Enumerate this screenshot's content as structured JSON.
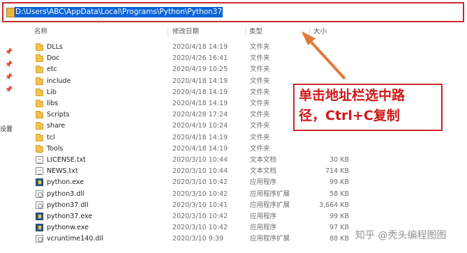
{
  "address_bar": {
    "path": "D:\\Users\\ABC\\AppData\\Local\\Programs\\Python\\Python37"
  },
  "columns": {
    "name": "名称",
    "date": "修改日期",
    "type": "类型",
    "size": "大小"
  },
  "left_panel": {
    "label": "设置"
  },
  "files": [
    {
      "name": "DLLs",
      "date": "2020/4/18 14:19",
      "type": "文件夹",
      "size": "",
      "icon": "folder"
    },
    {
      "name": "Doc",
      "date": "2020/4/26 16:41",
      "type": "文件夹",
      "size": "",
      "icon": "folder"
    },
    {
      "name": "etc",
      "date": "2020/4/19 10:25",
      "type": "文件夹",
      "size": "",
      "icon": "folder"
    },
    {
      "name": "include",
      "date": "2020/4/18 14:19",
      "type": "文件夹",
      "size": "",
      "icon": "folder"
    },
    {
      "name": "Lib",
      "date": "2020/4/18 14:19",
      "type": "文件夹",
      "size": "",
      "icon": "folder"
    },
    {
      "name": "libs",
      "date": "2020/4/18 14:19",
      "type": "文件夹",
      "size": "",
      "icon": "folder"
    },
    {
      "name": "Scripts",
      "date": "2020/4/28 17:24",
      "type": "文件夹",
      "size": "",
      "icon": "folder"
    },
    {
      "name": "share",
      "date": "2020/4/19 10:24",
      "type": "文件夹",
      "size": "",
      "icon": "folder"
    },
    {
      "name": "tcl",
      "date": "2020/4/18 14:19",
      "type": "文件夹",
      "size": "",
      "icon": "folder"
    },
    {
      "name": "Tools",
      "date": "2020/4/18 14:19",
      "type": "文件夹",
      "size": "",
      "icon": "folder"
    },
    {
      "name": "LICENSE.txt",
      "date": "2020/3/10 10:44",
      "type": "文本文档",
      "size": "30 KB",
      "icon": "text"
    },
    {
      "name": "NEWS.txt",
      "date": "2020/3/10 10:44",
      "type": "文本文档",
      "size": "714 KB",
      "icon": "text"
    },
    {
      "name": "python.exe",
      "date": "2020/3/10 10:42",
      "type": "应用程序",
      "size": "99 KB",
      "icon": "exe"
    },
    {
      "name": "python3.dll",
      "date": "2020/3/10 10:42",
      "type": "应用程序扩展",
      "size": "58 KB",
      "icon": "dll"
    },
    {
      "name": "python37.dll",
      "date": "2020/3/10 10:41",
      "type": "应用程序扩展",
      "size": "3,664 KB",
      "icon": "dll"
    },
    {
      "name": "python37.exe",
      "date": "2020/3/10 10:42",
      "type": "应用程序",
      "size": "99 KB",
      "icon": "exe"
    },
    {
      "name": "pythonw.exe",
      "date": "2020/3/10 10:42",
      "type": "应用程序",
      "size": "97 KB",
      "icon": "exe"
    },
    {
      "name": "vcruntime140.dll",
      "date": "2020/3/10 9:39",
      "type": "应用程序扩展",
      "size": "88 KB",
      "icon": "dll"
    }
  ],
  "annotation": {
    "line1": "单击地址栏选中路",
    "line2": "径，Ctrl+C复制"
  },
  "watermark": "知乎 @秃头编程图图",
  "colors": {
    "annotation_red": "#c92a2a",
    "selection_blue": "#0a64d8",
    "folder_yellow": "#f3c34d"
  }
}
